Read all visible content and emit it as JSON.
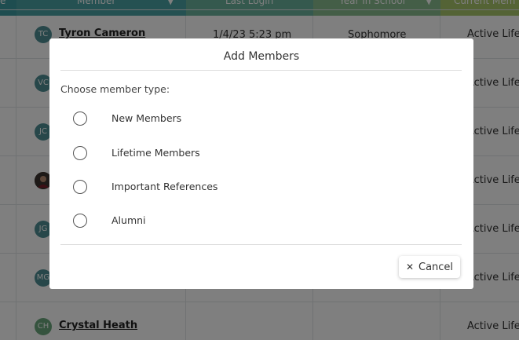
{
  "table": {
    "headers": [
      {
        "label": "e"
      },
      {
        "label": "Member"
      },
      {
        "label": "Last Login"
      },
      {
        "label": "Year In School"
      },
      {
        "label": "Current Mem"
      }
    ],
    "header_colors": [
      "#3c9aa0",
      "#4aa3a4",
      "#6ab39c",
      "#88bd8e",
      "#a9c66a"
    ],
    "rows": [
      {
        "initials": "TC",
        "name": "Tyron Cameron",
        "last_login": "1/4/23 5:23 pm",
        "year": "Sophomore",
        "status": "Active Lifet",
        "avatar_color": "#4e8f95"
      },
      {
        "initials": "VC",
        "name": "",
        "last_login": "",
        "year": "",
        "status": "Active Lifet",
        "avatar_color": "#4e8f95"
      },
      {
        "initials": "JC",
        "name": "",
        "last_login": "",
        "year": "",
        "status": "Active Lifet",
        "avatar_color": "#4e8f95"
      },
      {
        "initials": "",
        "name": "",
        "last_login": "",
        "year": "",
        "status": "Active Lifet",
        "avatar_color": "#5a4a3e"
      },
      {
        "initials": "JG",
        "name": "",
        "last_login": "",
        "year": "",
        "status": "Active Lifet",
        "avatar_color": "#4e8f95"
      },
      {
        "initials": "MG",
        "name": "",
        "last_login": "",
        "year": "",
        "status": "Active Lifet",
        "avatar_color": "#4e8f95"
      },
      {
        "initials": "CH",
        "name": "Crystal Heath",
        "last_login": "",
        "year": "",
        "status": "Active Lifet",
        "avatar_color": "#6aa77c"
      }
    ]
  },
  "modal": {
    "title": "Add Members",
    "prompt": "Choose member type:",
    "options": [
      {
        "label": "New Members",
        "selected": false
      },
      {
        "label": "Lifetime Members",
        "selected": false
      },
      {
        "label": "Important References",
        "selected": false
      },
      {
        "label": "Alumni",
        "selected": false
      }
    ],
    "cancel_label": "Cancel",
    "cancel_icon": "close-icon"
  }
}
